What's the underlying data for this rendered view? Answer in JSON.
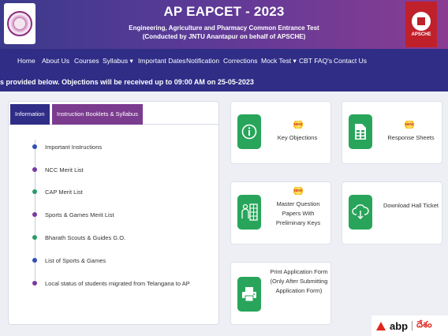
{
  "header": {
    "title": "AP EAPCET - 2023",
    "subtitle": "Engineering, Agriculture and Pharmacy Common Entrance Test",
    "conducted_by": "(Conducted by JNTU Anantapur on behalf of APSCHE)",
    "right_logo_letters": "APSCHE"
  },
  "nav": {
    "items": [
      {
        "label": "Home"
      },
      {
        "label": "About Us"
      },
      {
        "label": "Courses"
      },
      {
        "label": "Syllabus",
        "caret": "▾"
      },
      {
        "label": "Important Dates"
      },
      {
        "label": "Notification"
      },
      {
        "label": "Corrections"
      },
      {
        "label": "Mock Test",
        "caret": "▾"
      },
      {
        "label": "CBT FAQ's"
      },
      {
        "label": "Contact Us"
      }
    ]
  },
  "marquee": {
    "text": "s provided below. Objections will be received up to 09:00 AM on 25-05-2023"
  },
  "panel": {
    "tabs": [
      "Information",
      "Instruction Booklets & Syllabus"
    ],
    "list_items": [
      {
        "label": "Important Instructions",
        "color": "#2f4fb5"
      },
      {
        "label": "NCC Merit List",
        "color": "#7a3a9e"
      },
      {
        "label": "CAP Merit List",
        "color": "#2a9a6a"
      },
      {
        "label": "Sports & Games Merit List",
        "color": "#7a3a9e"
      },
      {
        "label": "Bharath Scouts & Guides G.O.",
        "color": "#2a9a6a"
      },
      {
        "label": "List of Sports & Games",
        "color": "#2f4fb5"
      },
      {
        "label": "Local status of students migrated from Telangana to AP",
        "color": "#7a3a9e"
      }
    ]
  },
  "cards": {
    "key_objections": {
      "label": "Key Objections",
      "badge": "NEW"
    },
    "response_sheets": {
      "label": "Response Sheets",
      "badge": "NEW"
    },
    "master_question": {
      "line1": "Master Question",
      "line2": "Papers With",
      "line3": "Preliminary Keys",
      "badge": "NEW"
    },
    "hall_ticket": {
      "label": "Download Hall Ticket"
    },
    "print_application": {
      "line1": "Print Application Form",
      "line2": "(Only After Submitting",
      "line3": "Application Form)"
    }
  },
  "watermark": {
    "brand": "abp",
    "native": "దేశం"
  },
  "colors": {
    "nav_bg": "#2f2d86",
    "accent_green": "#28a55a",
    "tab_inactive": "#7b3b8f"
  }
}
